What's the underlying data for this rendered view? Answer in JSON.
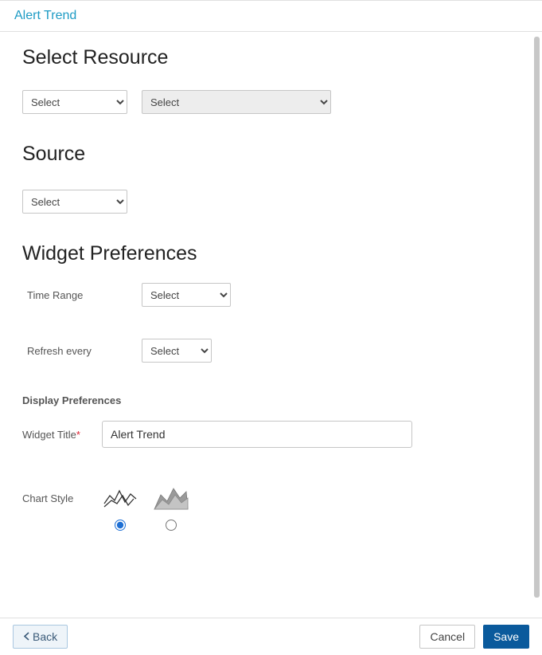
{
  "header": {
    "title": "Alert Trend"
  },
  "sections": {
    "select_resource": {
      "title": "Select Resource",
      "select1": "Select",
      "select2": "Select"
    },
    "source": {
      "title": "Source",
      "select": "Select"
    },
    "widget_prefs": {
      "title": "Widget Preferences",
      "time_range_label": "Time Range",
      "time_range_value": "Select",
      "refresh_label": "Refresh every",
      "refresh_value": "Select",
      "display_prefs_title": "Display Preferences",
      "widget_title_label": "Widget Title",
      "widget_title_value": "Alert Trend",
      "chart_style_label": "Chart Style",
      "chart_style_selected": "line"
    }
  },
  "footer": {
    "back": "Back",
    "cancel": "Cancel",
    "save": "Save"
  }
}
